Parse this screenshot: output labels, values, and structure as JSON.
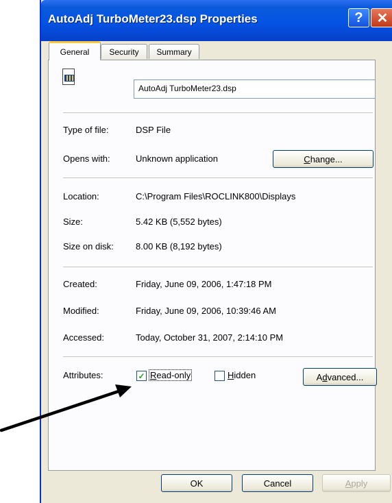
{
  "window": {
    "title": "AutoAdj TurboMeter23.dsp Properties",
    "help_label": "?",
    "close_label": "✕"
  },
  "tabs": [
    {
      "label": "General",
      "selected": true
    },
    {
      "label": "Security",
      "selected": false
    },
    {
      "label": "Summary",
      "selected": false
    }
  ],
  "file": {
    "icon": "dsp-file-icon",
    "name": "AutoAdj TurboMeter23.dsp"
  },
  "type_section": {
    "type_label": "Type of file:",
    "type_value": "DSP File",
    "opens_label": "Opens with:",
    "opens_value": "Unknown application",
    "change_button": {
      "prefix": "",
      "accel": "C",
      "suffix": "hange..."
    }
  },
  "location_section": {
    "location_label": "Location:",
    "location_value": "C:\\Program Files\\ROCLINK800\\Displays",
    "size_label": "Size:",
    "size_value": "5.42 KB (5,552 bytes)",
    "size_on_disk_label": "Size on disk:",
    "size_on_disk_value": "8.00 KB (8,192 bytes)"
  },
  "dates_section": {
    "created_label": "Created:",
    "created_value": "Friday, June 09, 2006, 1:47:18 PM",
    "modified_label": "Modified:",
    "modified_value": "Friday, June 09, 2006, 10:39:46 AM",
    "accessed_label": "Accessed:",
    "accessed_value": "Today, October 31, 2007, 2:14:10 PM"
  },
  "attributes": {
    "label": "Attributes:",
    "readonly": {
      "accel": "R",
      "rest": "ead-only",
      "checked": true,
      "check_glyph": "✓"
    },
    "hidden": {
      "accel": "H",
      "rest": "idden",
      "checked": false
    },
    "advanced_button": {
      "prefix": "A",
      "accel": "d",
      "suffix": "vanced..."
    }
  },
  "footer": {
    "ok_label": "OK",
    "cancel_label": "Cancel",
    "apply": {
      "accel": "A",
      "rest": "pply",
      "enabled": false
    }
  },
  "colors": {
    "titlebar": "#0553e5",
    "window_bg": "#ece9d8",
    "check_mark": "#21a121",
    "annotation_arrow": "#000000"
  }
}
